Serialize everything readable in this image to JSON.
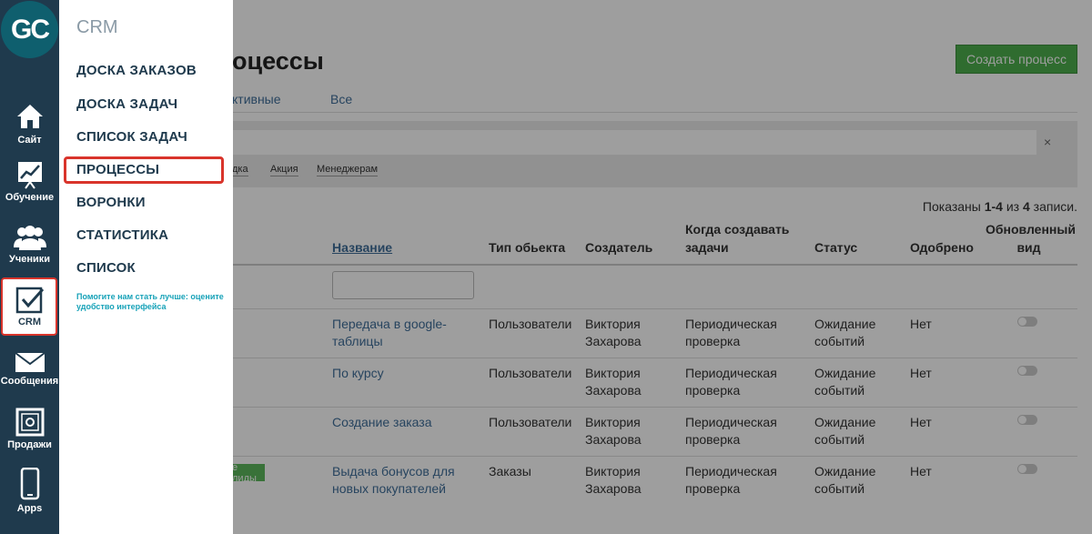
{
  "nav": {
    "logo_text": "GC",
    "items": [
      {
        "label": "Сайт",
        "icon": "home-icon"
      },
      {
        "label": "Обучение",
        "icon": "chart-board-icon"
      },
      {
        "label": "Ученики",
        "icon": "users-icon"
      },
      {
        "label": "CRM",
        "icon": "checkbox-icon"
      },
      {
        "label": "Сообщения",
        "icon": "envelope-icon"
      },
      {
        "label": "Продажи",
        "icon": "safe-icon"
      },
      {
        "label": "Apps",
        "icon": "phone-icon"
      }
    ]
  },
  "menu": {
    "title": "CRM",
    "items": [
      "ДОСКА ЗАКАЗОВ",
      "ДОСКА ЗАДАЧ",
      "СПИСОК ЗАДАЧ",
      "ПРОЦЕССЫ",
      "ВОРОНКИ",
      "СТАТИСТИКА",
      "СПИСОК"
    ],
    "feedback": "Помогите нам стать лучше: оцените удобство интерфейса"
  },
  "page": {
    "title": "оцессы",
    "create_button": "Создать процесс",
    "tabs": [
      "ктивные",
      "Все"
    ],
    "tags": [
      "дка",
      "Акция",
      "Менеджерам"
    ],
    "clear_symbol": "×",
    "shown_prefix": "Показаны ",
    "shown_range": "1-4",
    "shown_mid": " из ",
    "shown_total": "4",
    "shown_suffix": " записи."
  },
  "table": {
    "headers": {
      "name": "Название",
      "object_type": "Тип обьекта",
      "creator": "Создатель",
      "when_create_1": "Когда создавать",
      "when_create_2": "задачи",
      "status": "Статус",
      "approved": "Одобрено",
      "updated_1": "Обновленный",
      "updated_2": "вид"
    },
    "badge_text": "е лиды",
    "rows": [
      {
        "name_1": "Передача в google-",
        "name_2": "таблицы",
        "type": "Пользователи",
        "creator_1": "Виктория",
        "creator_2": "Захарова",
        "when_1": "Периодическая",
        "when_2": "проверка",
        "status_1": "Ожидание",
        "status_2": "событий",
        "approved": "Нет"
      },
      {
        "name_1": "По курсу",
        "name_2": "",
        "type": "Пользователи",
        "creator_1": "Виктория",
        "creator_2": "Захарова",
        "when_1": "Периодическая",
        "when_2": "проверка",
        "status_1": "Ожидание",
        "status_2": "событий",
        "approved": "Нет"
      },
      {
        "name_1": "Создание заказа",
        "name_2": "",
        "type": "Пользователи",
        "creator_1": "Виктория",
        "creator_2": "Захарова",
        "when_1": "Периодическая",
        "when_2": "проверка",
        "status_1": "Ожидание",
        "status_2": "событий",
        "approved": "Нет"
      },
      {
        "name_1": "Выдача бонусов для",
        "name_2": "новых покупателей",
        "type": "Заказы",
        "creator_1": "Виктория",
        "creator_2": "Захарова",
        "when_1": "Периодическая",
        "when_2": "проверка",
        "status_1": "Ожидание",
        "status_2": "событий",
        "approved": "Нет"
      }
    ]
  },
  "colors": {
    "nav_bg": "#1f3a4d",
    "highlight_red": "#d9342b",
    "create_green": "#4cae4c",
    "link_blue": "#3f6e9a",
    "feedback_teal": "#17a2b8"
  }
}
